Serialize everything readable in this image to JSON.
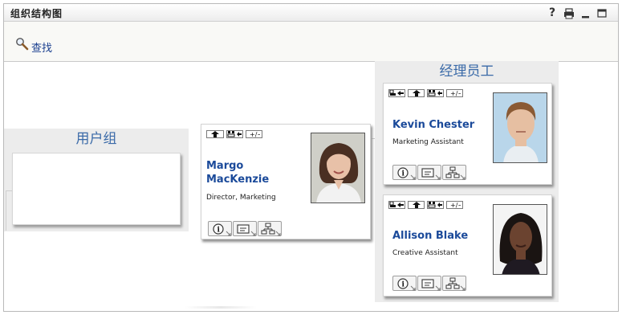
{
  "window": {
    "title": "组织结构图"
  },
  "titlebar_controls": [
    {
      "name": "help-icon",
      "glyph": "?"
    },
    {
      "name": "print-icon"
    },
    {
      "name": "minimize-icon"
    },
    {
      "name": "maximize-icon"
    }
  ],
  "toolbar": {
    "search_label": "查找",
    "search_icon": "magnifier-icon"
  },
  "sections": {
    "users": {
      "heading": "用户组"
    },
    "employees": {
      "heading": "经理员工"
    }
  },
  "focus_person": {
    "name": "Margo MacKenzie",
    "name_line1": "Margo",
    "name_line2": "MacKenzie",
    "title": "Director, Marketing",
    "nav_buttons": [
      "up-arrow-icon",
      "expand-org-icon",
      "plus-minus-icon"
    ]
  },
  "employees": [
    {
      "name": "Kevin Chester",
      "title": "Marketing Assistant",
      "nav_buttons": [
        "set-root-icon",
        "up-arrow-icon",
        "expand-org-icon",
        "plus-minus-icon"
      ]
    },
    {
      "name": "Allison Blake",
      "title": "Creative Assistant",
      "nav_buttons": [
        "set-root-icon",
        "up-arrow-icon",
        "expand-org-icon",
        "plus-minus-icon"
      ]
    }
  ],
  "card_actions": [
    "info-icon",
    "email-icon",
    "org-chart-icon"
  ],
  "colors": {
    "accent": "#1b4a9a",
    "section_heading": "#3a6aa8",
    "panel_bg": "#ececec"
  }
}
